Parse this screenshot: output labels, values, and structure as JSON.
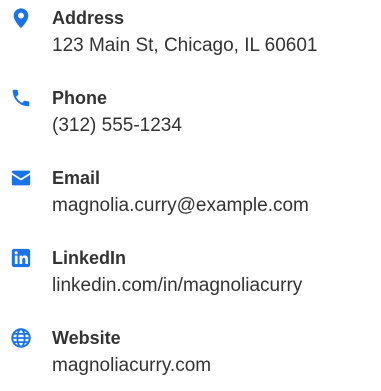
{
  "contact": {
    "accent_color": "#1a73e8",
    "items": [
      {
        "icon": "map-marker-icon",
        "label": "Address",
        "value": "123 Main St, Chicago, IL 60601"
      },
      {
        "icon": "phone-icon",
        "label": "Phone",
        "value": "(312) 555-1234"
      },
      {
        "icon": "envelope-icon",
        "label": "Email",
        "value": "magnolia.curry@example.com"
      },
      {
        "icon": "linkedin-icon",
        "label": "LinkedIn",
        "value": "linkedin.com/in/magnoliacurry"
      },
      {
        "icon": "globe-icon",
        "label": "Website",
        "value": "magnoliacurry.com"
      }
    ]
  }
}
